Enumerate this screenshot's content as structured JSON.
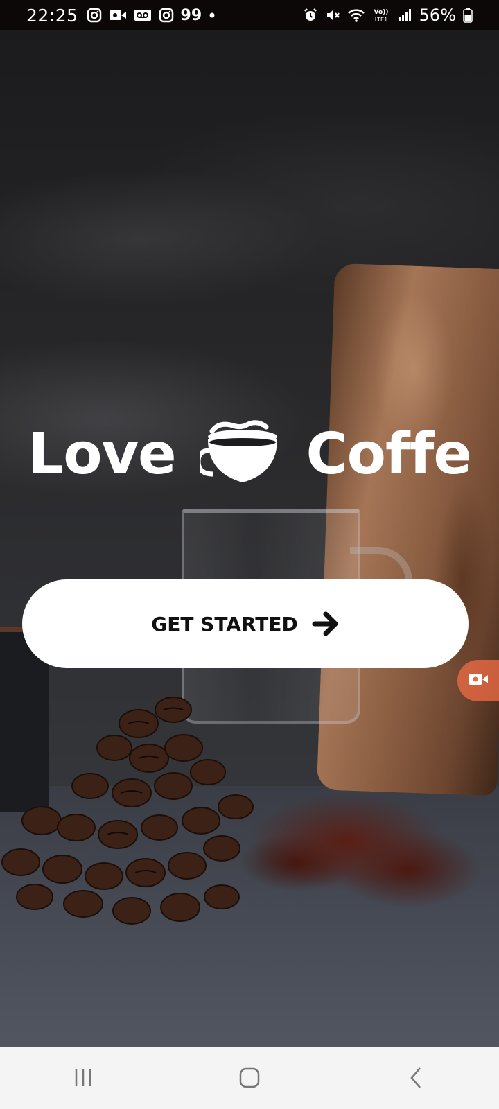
{
  "status_bar": {
    "time": "22:25",
    "notification_count": "99",
    "battery": "56%",
    "left_icons": [
      "instagram-icon",
      "video-icon",
      "voicemail-icon",
      "instagram-icon",
      "count-99",
      "dot-icon"
    ],
    "right_icons": [
      "alarm-icon",
      "mute-icon",
      "wifi-icon",
      "volte-icon",
      "signal-icon",
      "battery-icon"
    ]
  },
  "hero": {
    "word_left": "Love",
    "word_right": "Coffe",
    "icon": "coffee-cup-icon"
  },
  "cta": {
    "label": "GET STARTED",
    "icon": "arrow-right-icon"
  },
  "floating_button": {
    "icon": "video-record-icon",
    "color": "#e86a44"
  },
  "nav_bar": {
    "buttons": [
      "recents-icon",
      "home-icon",
      "back-icon"
    ]
  },
  "colors": {
    "status_bar_bg": "#0c0807",
    "cta_bg": "#ffffff",
    "cta_text": "#111111",
    "nav_bg": "#f4f4f4"
  }
}
